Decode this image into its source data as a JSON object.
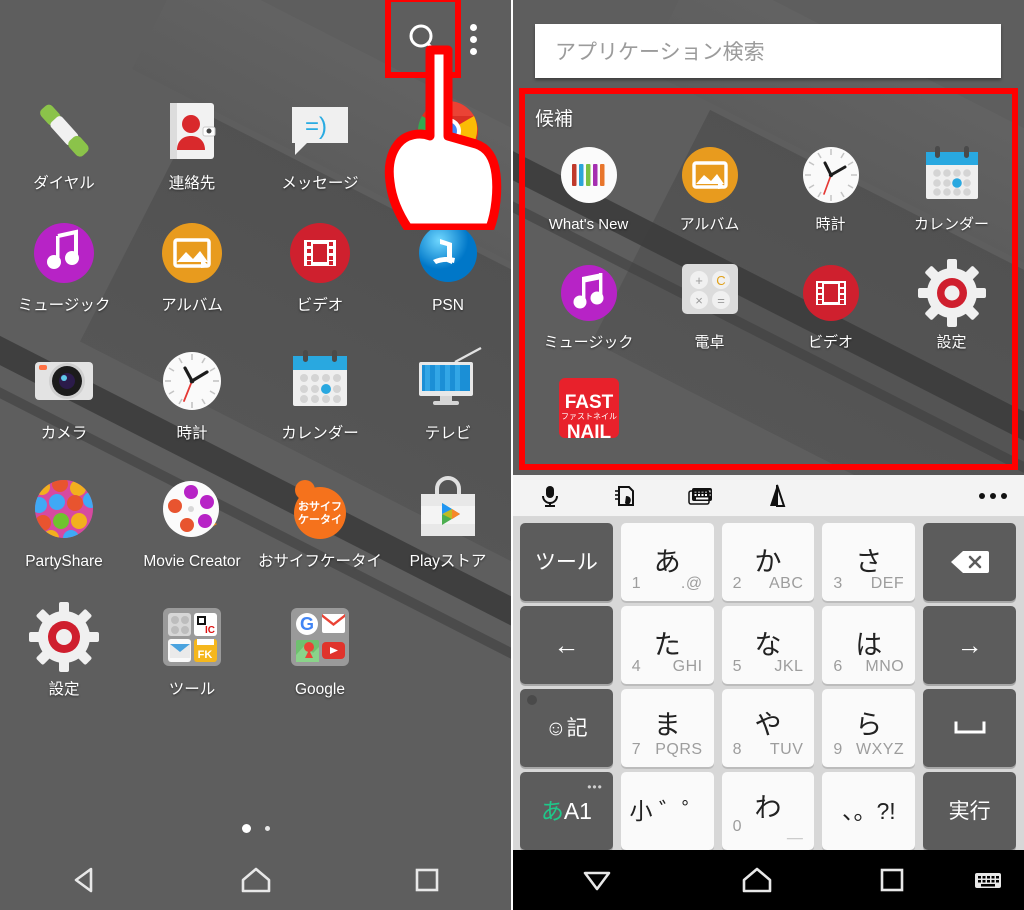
{
  "left_screen": {
    "topbar": {
      "search_icon": "search-icon",
      "overflow_icon": "kebab-menu-icon",
      "highlight_color": "#ff0000"
    },
    "app_grid": [
      [
        {
          "label": "ダイヤル",
          "icon": "phone-dialer-icon"
        },
        {
          "label": "連絡先",
          "icon": "contacts-icon"
        },
        {
          "label": "メッセージ",
          "icon": "messaging-icon"
        },
        {
          "label": "",
          "icon": "chrome-icon"
        }
      ],
      [
        {
          "label": "ミュージック",
          "icon": "music-icon"
        },
        {
          "label": "アルバム",
          "icon": "album-icon"
        },
        {
          "label": "ビデオ",
          "icon": "video-icon"
        },
        {
          "label": "PSN",
          "icon": "playstation-icon"
        }
      ],
      [
        {
          "label": "カメラ",
          "icon": "camera-icon"
        },
        {
          "label": "時計",
          "icon": "clock-icon"
        },
        {
          "label": "カレンダー",
          "icon": "calendar-icon"
        },
        {
          "label": "テレビ",
          "icon": "tv-icon"
        }
      ],
      [
        {
          "label": "PartyShare",
          "icon": "partyshare-icon"
        },
        {
          "label": "Movie Creator",
          "icon": "movie-creator-icon"
        },
        {
          "label": "おサイフケータイ",
          "icon": "osaifu-keitai-icon"
        },
        {
          "label": "Playストア",
          "icon": "play-store-icon"
        }
      ],
      [
        {
          "label": "設定",
          "icon": "settings-gear-icon"
        },
        {
          "label": "ツール",
          "icon": "tools-folder-icon"
        },
        {
          "label": "Google",
          "icon": "google-folder-icon"
        },
        {
          "label": "",
          "icon": ""
        }
      ]
    ],
    "page_indicator": {
      "total": 2,
      "current": 1
    },
    "navbar": [
      {
        "name": "back-button",
        "icon": "triangle-back-icon"
      },
      {
        "name": "home-button",
        "icon": "home-icon"
      },
      {
        "name": "recents-button",
        "icon": "square-recents-icon"
      }
    ]
  },
  "right_screen": {
    "search": {
      "placeholder": "アプリケーション検索",
      "value": ""
    },
    "suggestions": {
      "title": "候補",
      "highlight_color": "#ff0000",
      "items": [
        {
          "label": "What's New",
          "icon": "whats-new-icon"
        },
        {
          "label": "アルバム",
          "icon": "album-icon"
        },
        {
          "label": "時計",
          "icon": "clock-icon"
        },
        {
          "label": "カレンダー",
          "icon": "calendar-icon"
        },
        {
          "label": "ミュージック",
          "icon": "music-icon"
        },
        {
          "label": "電卓",
          "icon": "calculator-icon"
        },
        {
          "label": "ビデオ",
          "icon": "video-icon"
        },
        {
          "label": "設定",
          "icon": "settings-gear-icon"
        },
        {
          "label": "",
          "icon": "fastnail-icon"
        }
      ]
    },
    "ime_toolbar": [
      {
        "name": "voice-input-icon",
        "glyph": "🎤"
      },
      {
        "name": "handwriting-input-icon",
        "glyph": "✍"
      },
      {
        "name": "keyboard-switch-icon",
        "glyph": "⌨"
      },
      {
        "name": "leaf-badge-icon",
        "glyph": "🌱"
      },
      {
        "name": "more-options-icon",
        "glyph": "•••"
      }
    ],
    "keyboard": {
      "rows": [
        [
          {
            "name": "tool-key",
            "main": "ツール",
            "style": "dark"
          },
          {
            "name": "key-a",
            "main": "あ",
            "num": "1",
            "alpha": ".@",
            "style": "light"
          },
          {
            "name": "key-ka",
            "main": "か",
            "num": "2",
            "alpha": "ABC",
            "style": "light"
          },
          {
            "name": "key-sa",
            "main": "さ",
            "num": "3",
            "alpha": "DEF",
            "style": "light"
          },
          {
            "name": "backspace-key",
            "main": "⌫",
            "style": "dark"
          }
        ],
        [
          {
            "name": "cursor-left-key",
            "main": "←",
            "style": "dark"
          },
          {
            "name": "key-ta",
            "main": "た",
            "num": "4",
            "alpha": "GHI",
            "style": "light"
          },
          {
            "name": "key-na",
            "main": "な",
            "num": "5",
            "alpha": "JKL",
            "style": "light"
          },
          {
            "name": "key-ha",
            "main": "は",
            "num": "6",
            "alpha": "MNO",
            "style": "light"
          },
          {
            "name": "cursor-right-key",
            "main": "→",
            "style": "dark"
          }
        ],
        [
          {
            "name": "emoji-symbol-key",
            "main": "☺記",
            "style": "dark"
          },
          {
            "name": "key-ma",
            "main": "ま",
            "num": "7",
            "alpha": "PQRS",
            "style": "light"
          },
          {
            "name": "key-ya",
            "main": "や",
            "num": "8",
            "alpha": "TUV",
            "style": "light"
          },
          {
            "name": "key-ra",
            "main": "ら",
            "num": "9",
            "alpha": "WXYZ",
            "style": "light"
          },
          {
            "name": "space-key",
            "main": "␣",
            "style": "dark"
          }
        ],
        [
          {
            "name": "input-mode-key",
            "main": "あA1",
            "style": "dark"
          },
          {
            "name": "small-dakuten-key",
            "main": "小 ゛゜",
            "style": "light"
          },
          {
            "name": "key-wa",
            "main": "わ",
            "num": "0",
            "alpha": "＿",
            "style": "light"
          },
          {
            "name": "punctuation-key",
            "main": "、。?!",
            "style": "light"
          },
          {
            "name": "enter-key",
            "main": "実行",
            "style": "dark"
          }
        ]
      ]
    },
    "navbar": [
      {
        "name": "hide-keyboard-button",
        "icon": "triangle-down-icon"
      },
      {
        "name": "home-button",
        "icon": "home-icon"
      },
      {
        "name": "recents-button",
        "icon": "square-recents-icon"
      },
      {
        "name": "keyboard-picker-button",
        "icon": "keyboard-icon"
      }
    ]
  },
  "colors": {
    "wallpaper": "#5e5e5e",
    "highlight": "#ff0000",
    "key_light": "#fafafa",
    "key_dark": "#5c5c5c",
    "keyboard_bg": "#d7d7d7",
    "navbar_right_bg": "#000000"
  }
}
